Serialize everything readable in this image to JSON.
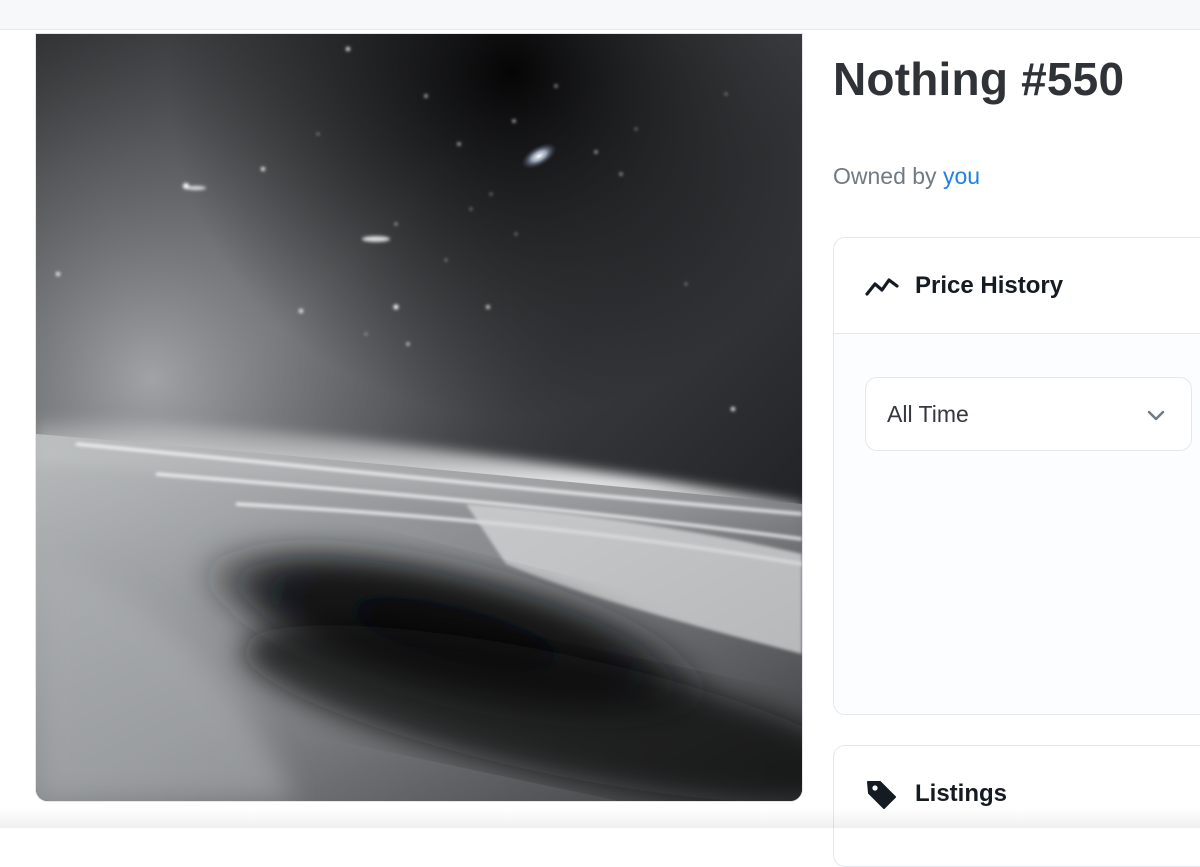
{
  "item": {
    "title": "Nothing #550",
    "owned_prefix": "Owned by",
    "owner": "you",
    "image_alt": "artwork"
  },
  "price_history": {
    "label": "Price History",
    "icon": "trend-line-icon",
    "range": {
      "selected": "All Time"
    }
  },
  "listings": {
    "label": "Listings",
    "icon": "tag-icon"
  },
  "colors": {
    "accent_link": "#2081e2",
    "title_text": "#2f3338",
    "muted_text": "#707a83",
    "border": "#e5e8eb"
  }
}
